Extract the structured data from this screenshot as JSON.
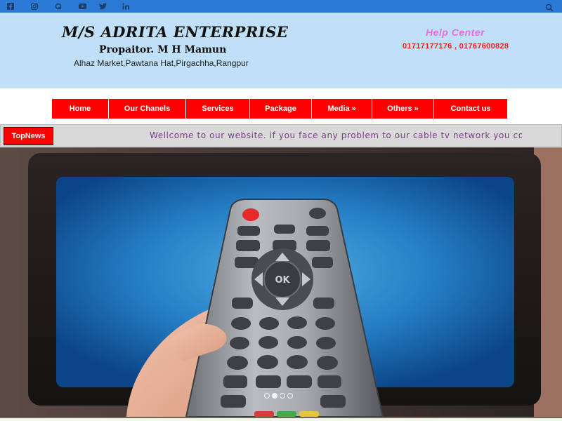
{
  "topbar": {
    "social_icons": [
      "facebook-icon",
      "instagram-icon",
      "quora-icon",
      "youtube-icon",
      "twitter-icon",
      "linkedin-icon"
    ],
    "search_icon": "search-icon",
    "color": "#2b7bd6"
  },
  "header": {
    "title": "M/S ADRITA ENTERPRISE",
    "owner": "Propaitor. M H Mamun",
    "address": "Alhaz Market,Pawtana Hat,Pirgachha,Rangpur",
    "help_title": "Help Center",
    "help_phones": "01717177176 , 01767600828",
    "background": "#bfe0f6"
  },
  "nav": {
    "items": [
      {
        "label": "Home"
      },
      {
        "label": "Our Chanels"
      },
      {
        "label": "Services"
      },
      {
        "label": "Package"
      },
      {
        "label": "Media »"
      },
      {
        "label": "Others »"
      },
      {
        "label": "Contact us"
      }
    ],
    "color": "#ff0000"
  },
  "ticker": {
    "label": "TopNews",
    "text": "Wellcome to our website. if you face any problem to our cable tv network you co"
  },
  "slider": {
    "image": "tv-remote-image",
    "dots": 4,
    "active_dot": 2
  }
}
